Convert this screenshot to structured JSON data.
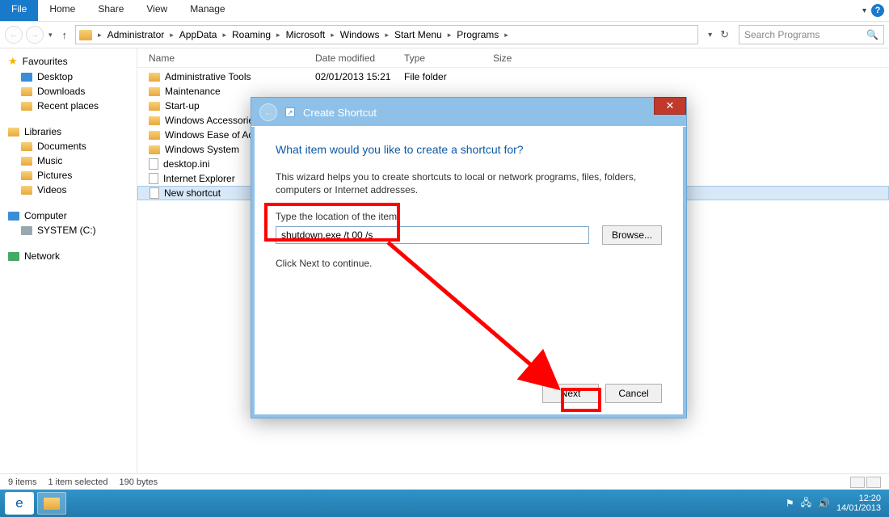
{
  "ribbon": {
    "file": "File",
    "tabs": [
      "Home",
      "Share",
      "View",
      "Manage"
    ],
    "help_glyph": "?"
  },
  "nav": {
    "crumbs": [
      "Administrator",
      "AppData",
      "Roaming",
      "Microsoft",
      "Windows",
      "Start Menu",
      "Programs"
    ],
    "search_placeholder": "Search Programs"
  },
  "columns": {
    "name": "Name",
    "date": "Date modified",
    "type": "Type",
    "size": "Size"
  },
  "sidebar": {
    "favourites": {
      "label": "Favourites",
      "items": [
        "Desktop",
        "Downloads",
        "Recent places"
      ]
    },
    "libraries": {
      "label": "Libraries",
      "items": [
        "Documents",
        "Music",
        "Pictures",
        "Videos"
      ]
    },
    "computer": {
      "label": "Computer",
      "items": [
        "SYSTEM (C:)"
      ]
    },
    "network": {
      "label": "Network"
    }
  },
  "files": [
    {
      "name": "Administrative Tools",
      "date": "02/01/2013 15:21",
      "type": "File folder",
      "kind": "folder"
    },
    {
      "name": "Maintenance",
      "kind": "folder"
    },
    {
      "name": "Start-up",
      "kind": "folder"
    },
    {
      "name": "Windows Accessories",
      "kind": "folder"
    },
    {
      "name": "Windows Ease of Access",
      "kind": "folder"
    },
    {
      "name": "Windows System",
      "kind": "folder"
    },
    {
      "name": "desktop.ini",
      "kind": "file"
    },
    {
      "name": "Internet Explorer",
      "kind": "file"
    },
    {
      "name": "New shortcut",
      "kind": "file",
      "selected": true
    }
  ],
  "status": {
    "items": "9 items",
    "selected": "1 item selected",
    "size": "190 bytes"
  },
  "tray": {
    "time": "12:20",
    "date": "14/01/2013"
  },
  "dialog": {
    "title": "Create Shortcut",
    "heading": "What item would you like to create a shortcut for?",
    "blurb": "This wizard helps you to create shortcuts to local or network programs, files, folders, computers or Internet addresses.",
    "field_label": "Type the location of the item:",
    "field_value": "shutdown.exe /t 00 /s",
    "browse": "Browse...",
    "continue_hint": "Click Next to continue.",
    "next": "Next",
    "cancel": "Cancel"
  }
}
